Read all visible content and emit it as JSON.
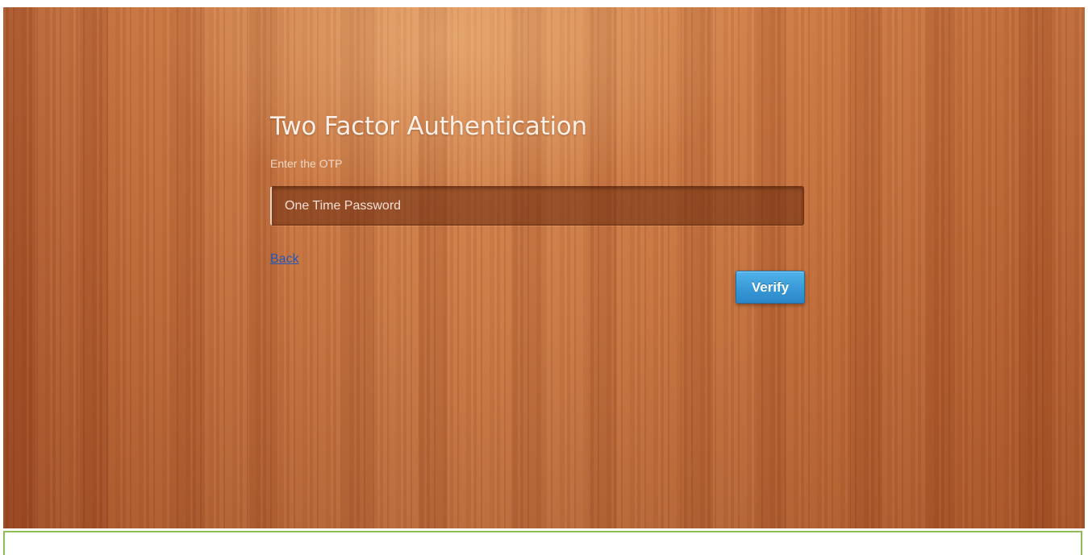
{
  "page": {
    "title": "Two Factor Authentication",
    "subtitle": "Enter the OTP"
  },
  "form": {
    "otp_placeholder": "One Time Password",
    "otp_value": "",
    "back_label": "Back",
    "verify_label": "Verify"
  },
  "colors": {
    "accent": "#3a9bd8",
    "link": "#2457b8",
    "frame": "#8fbd55"
  }
}
